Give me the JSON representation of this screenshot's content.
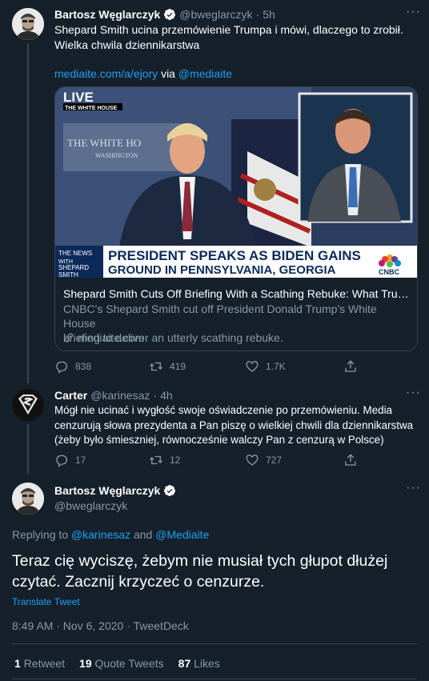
{
  "tweet1": {
    "name": "Bartosz Węglarczyk",
    "handle": "@bweglarczyk",
    "time": "5h",
    "text_line1": "Shepard Smith ucina przemówienie Trumpa i mówi, dlaczego to zrobił.",
    "text_line2": "Wielka chwila dziennikarstwa",
    "link": "mediaite.com/a/ejory",
    "via": "via",
    "via_account": "@mediaite",
    "card": {
      "live_label": "LIVE",
      "location_label": "THE WHITE HOUSE",
      "podium_text1": "THE WHITE HO",
      "podium_text2": "WASHINGTON",
      "ticker_news": "THE NEWS",
      "ticker_with": "WITH",
      "ticker_name1": "SHEPARD",
      "ticker_name2": "SMITH",
      "headline1": "PRESIDENT SPEAKS AS BIDEN GAINS",
      "headline2": "GROUND IN PENNSYLVANIA, GEORGIA",
      "network": "CNBC",
      "title": "Shepard Smith Cuts Off Briefing With a Scathing Rebuke: What Trum...",
      "desc_line1": "CNBC's Shepard Smith cut off President Donald Trump's White House",
      "desc_line2": "briefing to deliver an utterly scathing rebuke.",
      "domain": "mediaite.com"
    },
    "replies": "838",
    "retweets": "419",
    "likes": "1.7K"
  },
  "tweet2": {
    "name": "Carter",
    "handle": "@karinesaz",
    "time": "4h",
    "text_line1": "Mógł nie ucinać i wygłość swoje oświadczenie po przemówieniu. Media",
    "text_line2": "cenzurują słowa prezydenta a Pan piszę o wielkiej chwili dla dziennikarstwa",
    "text_line3": "(żeby było śmieszniej, równocześnie walczy Pan z cenzurą w Polsce)",
    "replies": "17",
    "retweets": "12",
    "likes": "727"
  },
  "main": {
    "name": "Bartosz Węglarczyk",
    "handle": "@bweglarczyk",
    "replying_prefix": "Replying to",
    "replying_to1": "@karinesaz",
    "replying_and": "and",
    "replying_to2": "@Mediaite",
    "text_line1": "Teraz cię wyciszę, żebym nie musiał tych głupot dłużej",
    "text_line2": "czytać. Zacznij krzyczeć o cenzurze.",
    "translate": "Translate Tweet",
    "timestamp": "8:49 AM · Nov 6, 2020 · TweetDeck",
    "retweets_count": "1",
    "retweets_label": "Retweet",
    "quotes_count": "19",
    "quotes_label": "Quote Tweets",
    "likes_count": "87",
    "likes_label": "Likes"
  },
  "colors": {
    "background": "#15202b",
    "accent": "#1da1f2",
    "muted": "#8899a6",
    "border": "#38444d"
  }
}
